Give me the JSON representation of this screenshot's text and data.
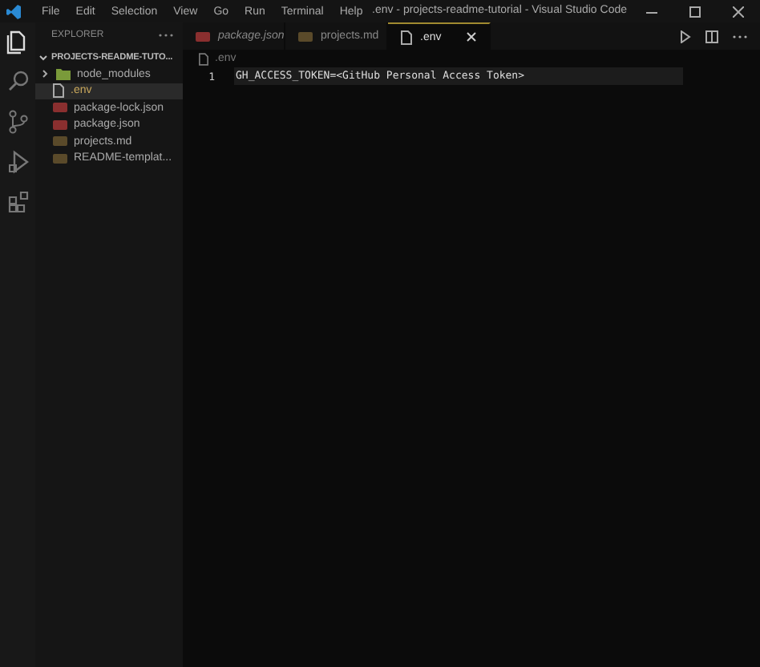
{
  "window": {
    "title": ".env - projects-readme-tutorial - Visual Studio Code"
  },
  "menu": [
    "File",
    "Edit",
    "Selection",
    "View",
    "Go",
    "Run",
    "Terminal",
    "Help"
  ],
  "activity_bar": [
    {
      "kind": "files",
      "selected": true
    },
    {
      "kind": "search",
      "selected": false
    },
    {
      "kind": "source-control",
      "selected": false
    },
    {
      "kind": "run",
      "selected": false
    },
    {
      "kind": "extensions",
      "selected": false
    }
  ],
  "sidebar": {
    "title": "EXPLORER",
    "folder": {
      "label": "PROJECTS-README-TUTO...",
      "expanded": true,
      "children": [
        {
          "label": "node_modules",
          "kind": "folder",
          "selected": false
        },
        {
          "label": ".env",
          "kind": "env",
          "selected": true
        },
        {
          "label": "package-lock.json",
          "kind": "json",
          "selected": false
        },
        {
          "label": "package.json",
          "kind": "json",
          "selected": false
        },
        {
          "label": "projects.md",
          "kind": "md",
          "selected": false
        },
        {
          "label": "README-templat...",
          "kind": "md",
          "selected": false
        }
      ]
    }
  },
  "tabs": [
    {
      "label": "package.json",
      "kind": "json",
      "preview": true,
      "selected": false
    },
    {
      "label": "projects.md",
      "kind": "md",
      "preview": false,
      "selected": false
    },
    {
      "label": ".env",
      "kind": "env",
      "preview": false,
      "selected": true
    }
  ],
  "breadcrumb": ".env",
  "editor": {
    "lines": [
      {
        "number": "1",
        "text": "GH_ACCESS_TOKEN=<GitHub Personal Access Token>",
        "current": true
      }
    ]
  }
}
